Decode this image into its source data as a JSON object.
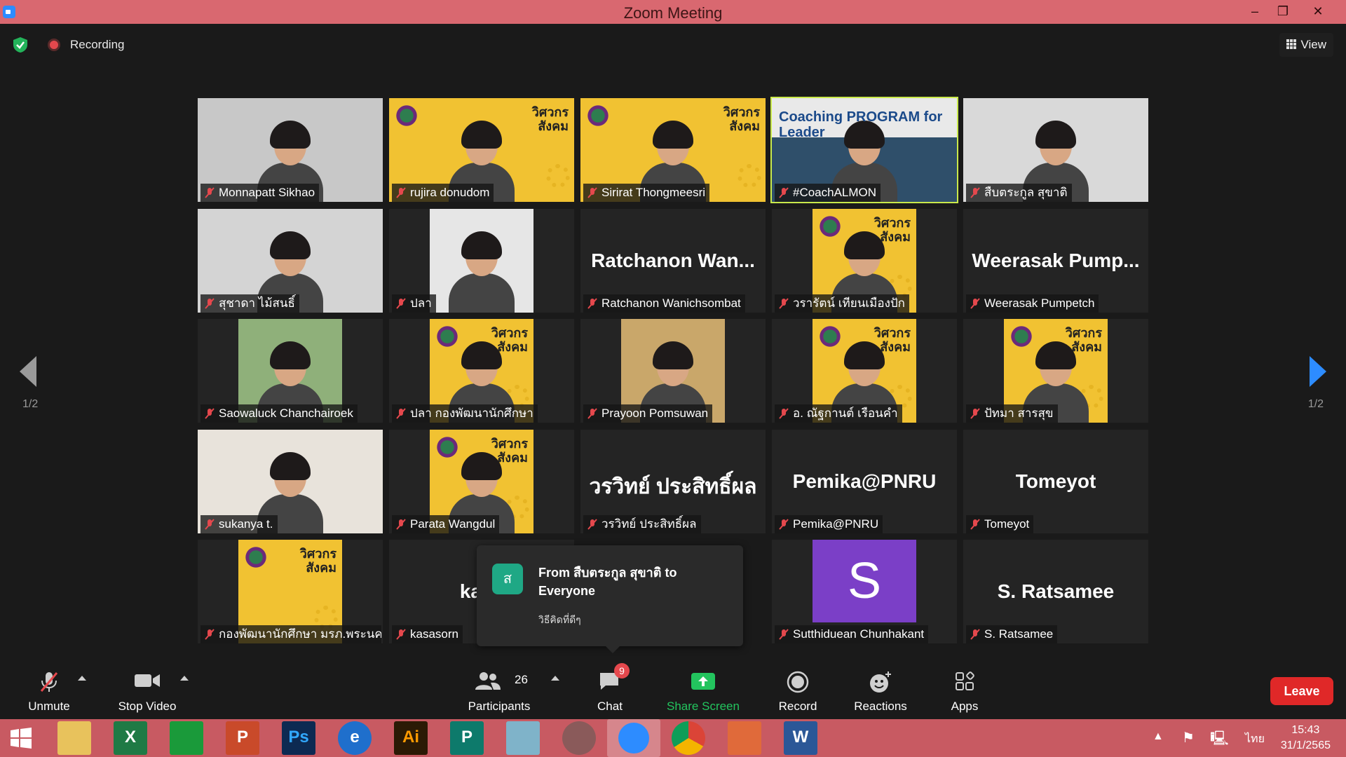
{
  "window": {
    "title": "Zoom Meeting",
    "min": "–",
    "max": "❐",
    "close": "✕"
  },
  "topbar": {
    "recording_label": "Recording",
    "view_label": "View"
  },
  "pager": {
    "left": "1/2",
    "right": "1/2"
  },
  "participants": [
    {
      "name": "Monnapatt Sikhao",
      "kind": "video",
      "bg": "#c8c8c8"
    },
    {
      "name": "rujira donudom",
      "kind": "banner"
    },
    {
      "name": "Sirirat Thongmeesri",
      "kind": "banner"
    },
    {
      "name": "#CoachALMON",
      "kind": "coach",
      "active": true,
      "overlay": "Coaching PROGRAM for Leader"
    },
    {
      "name": "สืบตระกูล สุขาติ",
      "kind": "video",
      "bg": "#d9d9d9"
    },
    {
      "name": "สุชาดา ไม้สนธิ์",
      "kind": "video",
      "bg": "#d4d4d4"
    },
    {
      "name": "ปลา",
      "kind": "video",
      "bg": "#e6e6e6"
    },
    {
      "name": "Ratchanon Wanichsombat",
      "kind": "text",
      "display": "Ratchanon  Wan..."
    },
    {
      "name": "วรารัตน์ เทียนเมืองปัก",
      "kind": "banner"
    },
    {
      "name": "Weerasak Pumpetch",
      "kind": "text",
      "display": "Weerasak  Pump..."
    },
    {
      "name": "Saowaluck Chanchairoek",
      "kind": "video",
      "bg": "#8fb07a"
    },
    {
      "name": "ปลา กองพัฒนานักศึกษา",
      "kind": "banner"
    },
    {
      "name": "Prayoon Pomsuwan",
      "kind": "video",
      "bg": "#c9a76a"
    },
    {
      "name": "อ. ณัฐกานต์ เรือนคำ",
      "kind": "banner"
    },
    {
      "name": "ปัทมา สารสุข",
      "kind": "banner"
    },
    {
      "name": "sukanya t.",
      "kind": "video",
      "bg": "#e8e3db"
    },
    {
      "name": "Parata Wangdul",
      "kind": "banner"
    },
    {
      "name": "วรวิทย์ ประสิทธิ์ผล",
      "kind": "text",
      "display": "วรวิทย์ ประสิทธิ์ผล"
    },
    {
      "name": "Pemika@PNRU",
      "kind": "text",
      "display": "Pemika@PNRU"
    },
    {
      "name": "Tomeyot",
      "kind": "text",
      "display": "Tomeyot"
    },
    {
      "name": "กองพัฒนานักศึกษา มรภ.พระนคร",
      "kind": "logo"
    },
    {
      "name": "kasasorn",
      "kind": "text",
      "display": "kasa"
    },
    {
      "name": "",
      "kind": "hidden"
    },
    {
      "name": "Sutthiduean Chunhakant",
      "kind": "avatar",
      "initial": "S"
    },
    {
      "name": "S. Ratsamee",
      "kind": "text",
      "display": "S. Ratsamee"
    }
  ],
  "chat_popup": {
    "avatar_letter": "ส",
    "from": "From สืบตระกูล สุขาติ to Everyone",
    "message": "วิธีคิดที่ดีๆ"
  },
  "toolbar": {
    "unmute": "Unmute",
    "stop_video": "Stop Video",
    "participants_label": "Participants",
    "participants_count": "26",
    "chat_label": "Chat",
    "chat_badge": "9",
    "share_label": "Share Screen",
    "record_label": "Record",
    "reactions_label": "Reactions",
    "apps_label": "Apps",
    "leave_label": "Leave"
  },
  "taskbar": {
    "apps": [
      "start",
      "file-explorer",
      "excel",
      "store",
      "powerpoint",
      "photoshop",
      "internet-explorer",
      "illustrator",
      "publisher",
      "notes",
      "photoscape",
      "zoom",
      "chrome",
      "slides",
      "word"
    ],
    "lang": "ไทย",
    "time": "15:43",
    "date": "31/1/2565"
  }
}
